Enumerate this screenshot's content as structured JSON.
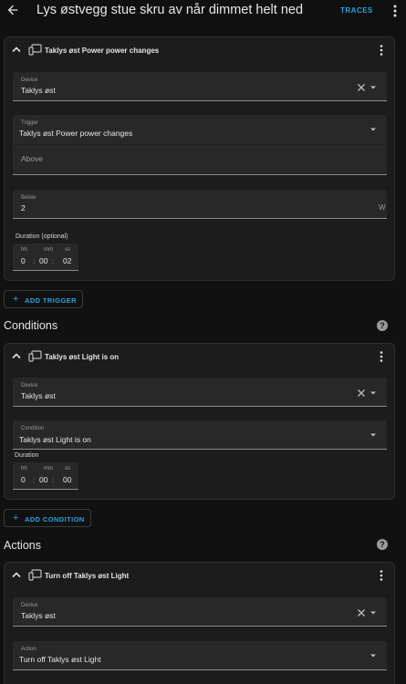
{
  "header": {
    "back_icon": "arrow-left-icon",
    "title": "Lys østvegg stue skru av når dimmet helt ned",
    "traces_label": "TRACES",
    "menu_icon": "dots-vertical-icon"
  },
  "colors": {
    "background": "#111111",
    "card": "#1c1c1c",
    "field": "#282828",
    "accent": "#2aa3dd",
    "text": "#e6e6e6",
    "muted": "#9a9a9a"
  },
  "trigger": {
    "title": "Taklys øst Power power changes",
    "device": {
      "label": "Device",
      "value": "Taklys øst"
    },
    "trigger_field": {
      "label": "Trigger",
      "value": "Taklys øst Power power changes"
    },
    "above": {
      "placeholder": "Above"
    },
    "below": {
      "label": "Below",
      "value": "2",
      "unit": "W"
    },
    "duration": {
      "label": "Duration (optional)",
      "hh_label": "hh",
      "hh": "0",
      "mm_label": "mm",
      "mm": "00",
      "ss_label": "ss",
      "ss": "02",
      "sep": ":"
    },
    "add_label": "ADD TRIGGER"
  },
  "conditions": {
    "heading": "Conditions",
    "help_icon": "help-circle-icon",
    "card": {
      "title": "Taklys øst Light is on",
      "device": {
        "label": "Device",
        "value": "Taklys øst"
      },
      "condition_field": {
        "label": "Condition",
        "value": "Taklys øst Light is on"
      },
      "duration": {
        "label": "Duration",
        "hh_label": "hh",
        "hh": "0",
        "mm_label": "mm",
        "mm": "00",
        "ss_label": "ss",
        "ss": "00",
        "sep": ":"
      }
    },
    "add_label": "ADD CONDITION"
  },
  "actions": {
    "heading": "Actions",
    "help_icon": "help-circle-icon",
    "card": {
      "title": "Turn off Taklys øst Light",
      "device": {
        "label": "Device",
        "value": "Taklys øst"
      },
      "action_field": {
        "label": "Action",
        "value": "Turn off Taklys øst Light"
      }
    }
  }
}
